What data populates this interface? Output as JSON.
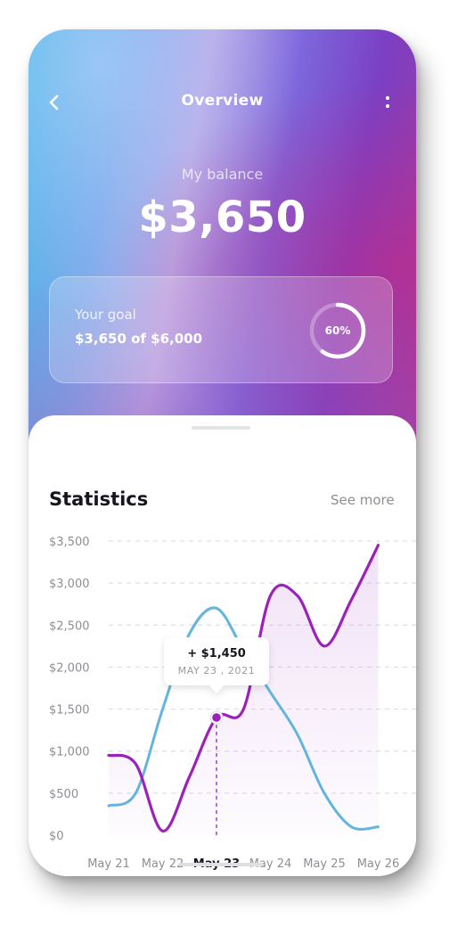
{
  "header": {
    "title": "Overview",
    "back_icon": "chevron-left-icon",
    "menu_icon": "more-vertical-icon"
  },
  "balance": {
    "label": "My balance",
    "value": "$3,650"
  },
  "goal": {
    "label": "Your goal",
    "amount": "$3,650 of $6,000",
    "percent": 0.6,
    "percent_label": "60%"
  },
  "statistics": {
    "title": "Statistics",
    "see_more": "See more"
  },
  "tooltip": {
    "value": "+ $1,450",
    "date": "MAY 23 , 2021"
  },
  "colors": {
    "purple_series": "#9b22b8",
    "blue_series": "#63b4de",
    "selected_x_label": "#15161c",
    "muted_text": "#8e8e95"
  },
  "chart_data": {
    "type": "line",
    "categories": [
      "May 21",
      "May 22",
      "May 23",
      "May 24",
      "May 25",
      "May 26"
    ],
    "selected_category": "May 23",
    "ylim": [
      0,
      3500
    ],
    "y_ticks": [
      "$3,500",
      "$3,000",
      "$2,500",
      "$2,000",
      "$1,500",
      "$1,000",
      "$500",
      "$0"
    ],
    "grid": "horizontal-dashed",
    "series": [
      {
        "color": "purple",
        "x": [
          0,
          0.5,
          1,
          1.5,
          2,
          2.5,
          3,
          3.5,
          4,
          4.5,
          5
        ],
        "values": [
          950,
          850,
          50,
          700,
          1400,
          1500,
          2850,
          2850,
          2250,
          2800,
          3450
        ]
      },
      {
        "color": "blue",
        "x": [
          0,
          0.5,
          1,
          1.5,
          2,
          2.5,
          3,
          3.5,
          4,
          4.5,
          5
        ],
        "values": [
          350,
          500,
          1500,
          2400,
          2700,
          2200,
          1700,
          1200,
          500,
          100,
          100
        ]
      }
    ]
  }
}
